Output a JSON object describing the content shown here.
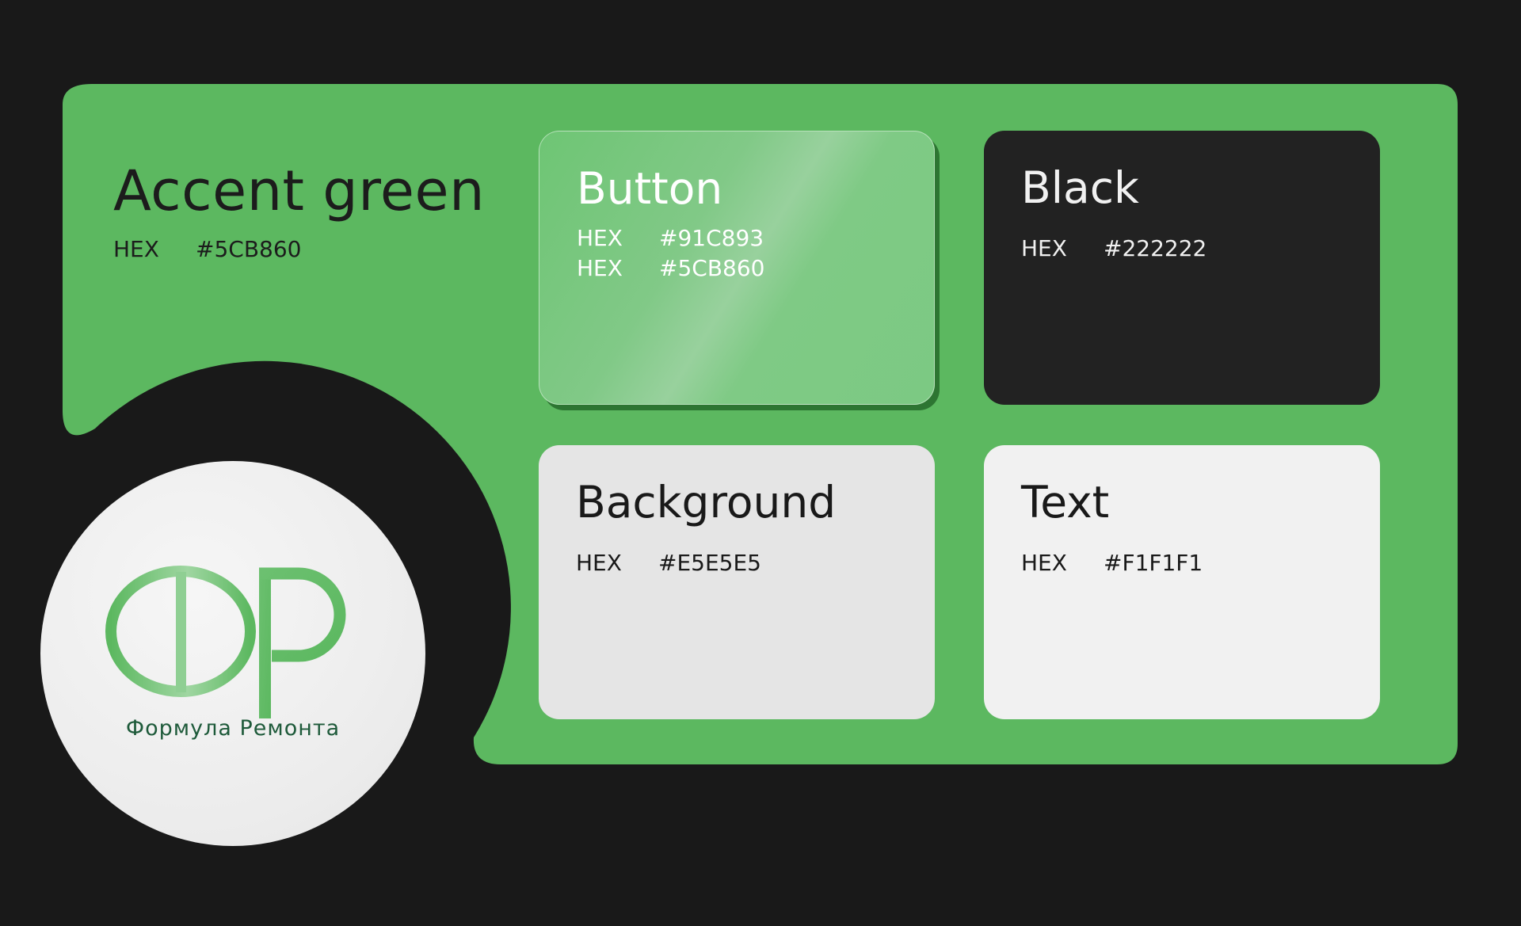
{
  "colors": {
    "page_bg": "#191919",
    "panel": "#5CB860",
    "button_light": "#91C893",
    "black": "#222222",
    "background": "#E5E5E5",
    "text": "#F1F1F1",
    "logo_text": "#1E5A3A"
  },
  "accent": {
    "title": "Accent green",
    "hex_label": "HEX",
    "hex_value": "#5CB860"
  },
  "cards": {
    "button": {
      "title": "Button",
      "rows": [
        {
          "label": "HEX",
          "value": "#91C893"
        },
        {
          "label": "HEX",
          "value": "#5CB860"
        }
      ]
    },
    "black": {
      "title": "Black",
      "hex_label": "HEX",
      "hex_value": "#222222"
    },
    "background": {
      "title": "Background",
      "hex_label": "HEX",
      "hex_value": "#E5E5E5"
    },
    "text": {
      "title": "Text",
      "hex_label": "HEX",
      "hex_value": "#F1F1F1"
    }
  },
  "logo": {
    "icon": "fr-monogram-icon",
    "caption": "Формула Ремонта"
  }
}
